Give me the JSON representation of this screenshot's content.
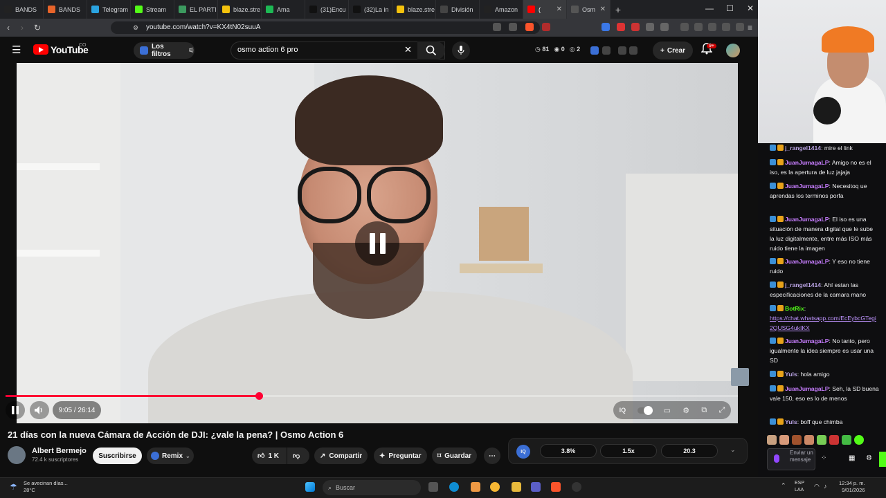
{
  "browser": {
    "tabs": [
      {
        "label": "BANDS",
        "icon": "m-icon",
        "color": "#222222"
      },
      {
        "label": "BANDS",
        "icon": "bands-icon",
        "color": "#e8642a"
      },
      {
        "label": "Telegram",
        "icon": "telegram-icon",
        "color": "#2aa3e0"
      },
      {
        "label": "Stream",
        "icon": "kick-icon",
        "color": "#53fc18"
      },
      {
        "label": "EL PARTI",
        "icon": "document-icon",
        "color": "#3c9a5f"
      },
      {
        "label": "blaze.stre",
        "icon": "blaze-icon",
        "color": "#f4c20d"
      },
      {
        "label": "Ama",
        "icon": "spotify-icon",
        "color": "#1db954"
      },
      {
        "label": "(31)Encu",
        "icon": "tiktok-icon",
        "color": "#111111"
      },
      {
        "label": "(32)La in",
        "icon": "tiktok-icon",
        "color": "#111111"
      },
      {
        "label": "blaze.stre",
        "icon": "blaze-icon",
        "color": "#f4c20d"
      },
      {
        "label": "División",
        "icon": "chatgpt-icon",
        "color": "#444444"
      },
      {
        "label": "Amazon",
        "icon": "amazon-icon",
        "color": "#222222"
      },
      {
        "label": "(",
        "icon": "youtube-icon",
        "color": "#ff0000"
      },
      {
        "label": "Osm",
        "icon": "osmo-icon",
        "color": "#555555"
      }
    ],
    "url": "youtube.com/watch?v=KX4tN02suuA"
  },
  "youtube": {
    "logo_text": "YouTube",
    "logo_country": "CO",
    "filters_label": "Los filtros",
    "search_value": "osmo action 6 pro",
    "stats": [
      "81",
      "0",
      "2"
    ],
    "create_label": "Crear",
    "notif_count": "9+"
  },
  "player": {
    "progress_fraction": 0.346,
    "time": "9:05 / 26:14"
  },
  "video_info": {
    "title": "21 días con la nueva Cámara de Acción de DJI: ¿vale la pena? | Osmo Action 6",
    "channel": "Albert Bermejo",
    "subscribers": "72.4 k suscriptores",
    "subscribe_label": "Suscribirse",
    "remix_label": "Remix",
    "likes": "1 K",
    "share_label": "Compartir",
    "ask_label": "Preguntar",
    "save_label": "Guardar"
  },
  "iq_panel": {
    "values": [
      "3.8%",
      "1.5x",
      "20.3"
    ]
  },
  "chat": {
    "messages": [
      {
        "user": "j_rangel1414",
        "text": ": mire el link",
        "color": "#b9a3e3"
      },
      {
        "user": "JuanJumagaLP",
        "text": ": Amigo no es el iso, es la apertura de luz jajaja",
        "color": "#c77dff"
      },
      {
        "user": "JuanJumagaLP",
        "text": ": Necesitoq ue aprendas los terminos porfa",
        "color": "#c77dff"
      },
      {
        "user": "JuanJumagaLP",
        "text": ": El iso es una situación de manera digital que le sube la luz digitalmente, entre más ISO más ruido tiene la imagen",
        "color": "#c77dff"
      },
      {
        "user": "JuanJumagaLP",
        "text": ": Y eso no tiene ruido",
        "color": "#c77dff"
      },
      {
        "user": "j_rangel1414",
        "text": ": Ahí estan las especificaciones de la camara mano",
        "color": "#b9a3e3"
      },
      {
        "user": "BotRix",
        "text": ":",
        "link": "https://chat.whatsapp.com/EcEybcGTegi2QUSG4ukIKX",
        "color": "#53fc18"
      },
      {
        "user": "JuanJumagaLP",
        "text": ": No tanto, pero igualmente la idea siempre es usar una SD",
        "color": "#c77dff"
      },
      {
        "user": "Yuls",
        "text": ": hola amigo",
        "color": "#b9a3e3"
      },
      {
        "user": "JuanJumagaLP",
        "text": ": Seh, la SD buena vale 150, eso es lo de menos",
        "color": "#c77dff"
      },
      {
        "user": "Yuls",
        "text": ": boff que chimba",
        "color": "#b9a3e3"
      }
    ],
    "input_placeholder": "Enviar un mensaje"
  },
  "taskbar": {
    "weather_text": "Se avecinan días...",
    "temperature": "28°C",
    "search_label": "Buscar",
    "lang": "ESP",
    "lang_sub": "LAA",
    "time": "12:34 p. m.",
    "date": "9/01/2026"
  }
}
